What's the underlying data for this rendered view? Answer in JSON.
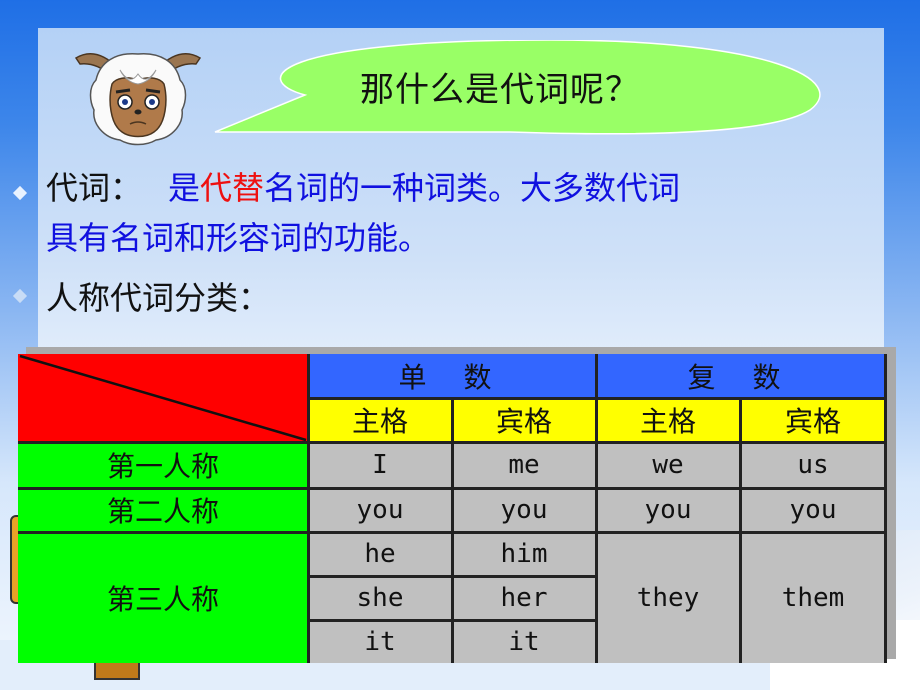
{
  "slide": {
    "speech_bubble": "那什么是代词呢？",
    "definition": {
      "label": "代词：",
      "part1": "是",
      "highlight": "代替",
      "part2": "名词的一种词类。大多数代词",
      "line2": "具有名词和形容词的功能。"
    },
    "subheading": "人称代词分类：",
    "colors": {
      "highlight_red": "#ee1010",
      "definition_blue": "#1010e0",
      "bubble_green": "#99ff66",
      "header_blue": "#3366ff",
      "header_yellow": "#ffff00",
      "row_green": "#00ff00",
      "corner_red": "#ff0000",
      "cell_gray": "#c0c0c0"
    },
    "icons": {
      "character": "goat-character-icon",
      "bullet": "diamond-bullet-icon"
    }
  },
  "table": {
    "groups": [
      "单 数",
      "复 数"
    ],
    "case_headers": [
      "主格",
      "宾格",
      "主格",
      "宾格"
    ],
    "rows": [
      {
        "label": "第一人称",
        "values": [
          [
            "I"
          ],
          [
            "me"
          ],
          [
            "we"
          ],
          [
            "us"
          ]
        ]
      },
      {
        "label": "第二人称",
        "values": [
          [
            "you"
          ],
          [
            "you"
          ],
          [
            "you"
          ],
          [
            "you"
          ]
        ]
      },
      {
        "label": "第三人称",
        "values": [
          [
            "he",
            "she",
            "it"
          ],
          [
            "him",
            "her",
            "it"
          ],
          [
            "they"
          ],
          [
            "them"
          ]
        ]
      }
    ]
  }
}
